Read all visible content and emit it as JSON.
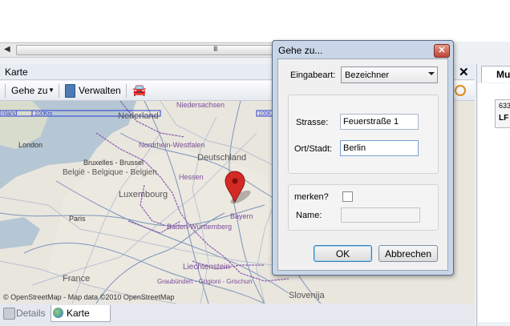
{
  "scrollbar": {
    "grip": "III"
  },
  "panel": {
    "title": "Karte",
    "close": "✕"
  },
  "toolbar": {
    "goto_label": "Gehe zu",
    "manage_label": "Verwalten"
  },
  "map": {
    "labels": [
      "Niedersachsen",
      "Nederland",
      "London",
      "Nordrhein-Westfalen",
      "Deutschland",
      "Bruxelles - Brussel",
      "België - Belgique - Belgien",
      "Hessen",
      "Luxembourg",
      "Paris",
      "Bayern",
      "Baden-Württemberg",
      "Liechtenstein",
      "Graubünden - Grigioni - Grischun",
      "France",
      "Slovenija"
    ],
    "scale_left": "100Km",
    "scale_right": "100Km",
    "attribution": "© OpenStreetMap - Map data ©2010 OpenStreetMap"
  },
  "tabs": {
    "details": "Details",
    "karte": "Karte"
  },
  "right_panel": {
    "tab_label": "Mu",
    "card_line1": "633",
    "card_line2": "LF"
  },
  "dialog": {
    "title": "Gehe zu...",
    "close": "✕",
    "type_label": "Eingabeart:",
    "type_value": "Bezeichner",
    "street_label": "Strasse:",
    "street_value": "Feuerstraße 1",
    "city_label": "Ort/Stadt:",
    "city_value": "Berlin",
    "remember_label": "merken?",
    "name_label": "Name:",
    "name_value": "",
    "ok": "OK",
    "cancel": "Abbrechen"
  },
  "colors": {
    "pin": "#d42a25",
    "border_line": "#8a5fb0",
    "scale": "#2a3fcf",
    "dialog_frame": "#c8d6e8"
  }
}
